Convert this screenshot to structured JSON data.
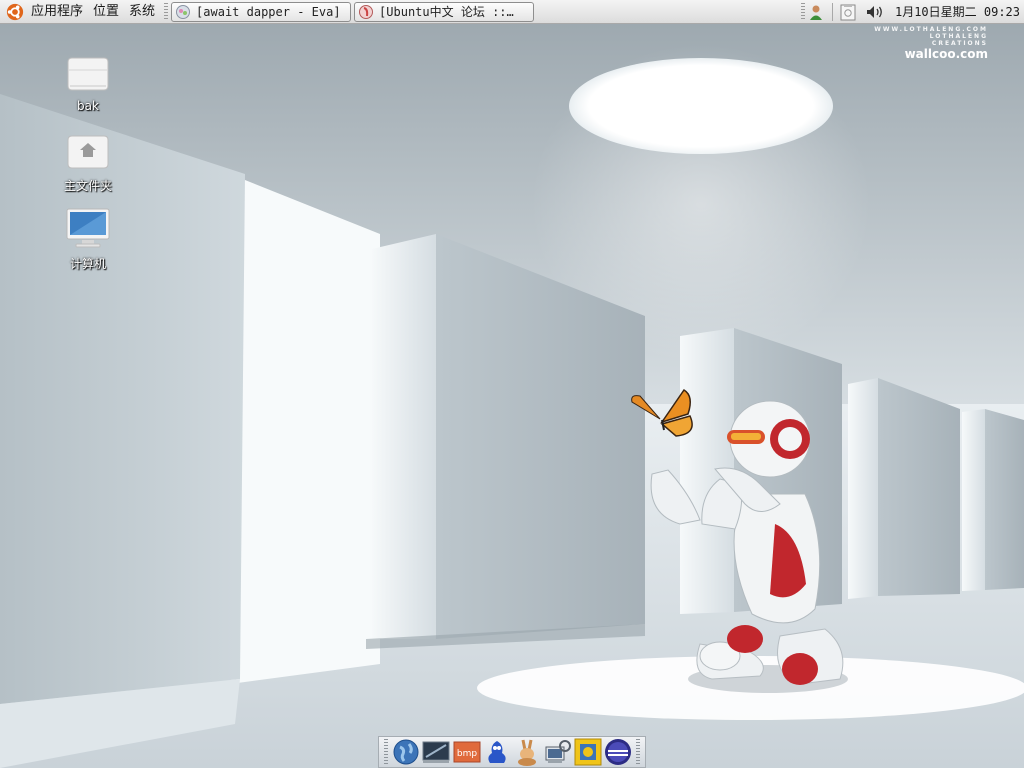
{
  "top_panel": {
    "menus": [
      "应用程序",
      "位置",
      "系统"
    ],
    "tasks": [
      {
        "label": "[await dapper - Eva]",
        "icon": "music-player-icon"
      },
      {
        "label": "[Ubuntu中文 论坛 ::…",
        "icon": "firefox-icon"
      }
    ],
    "tray_icons": [
      "user-switcher-icon",
      "clipboard-icon",
      "volume-icon"
    ],
    "clock": "1月10日星期二 09:23"
  },
  "watermark": {
    "line1": "WWW.LOTHALENG.COM",
    "line2": "LOTHALENG",
    "line3": "CREATIONS",
    "site": "wallcoo.com"
  },
  "desktop_icons": [
    {
      "label": "bak",
      "icon": "folder-icon"
    },
    {
      "label": "主文件夹",
      "icon": "home-folder-icon"
    },
    {
      "label": "计算机",
      "icon": "computer-icon"
    }
  ],
  "dock": {
    "launchers": [
      "web-browser-icon",
      "terminal-icon",
      "bmp-image-icon",
      "gaim-icon",
      "rabbit-icon",
      "remote-desktop-icon",
      "puzzle-icon",
      "eclipse-icon"
    ]
  },
  "colors": {
    "panel": "#e4e4e4",
    "wallpaper_light": "#f4f7f9",
    "wallpaper_mid": "#aeb8bf",
    "robot_accent": "#c1272d"
  }
}
